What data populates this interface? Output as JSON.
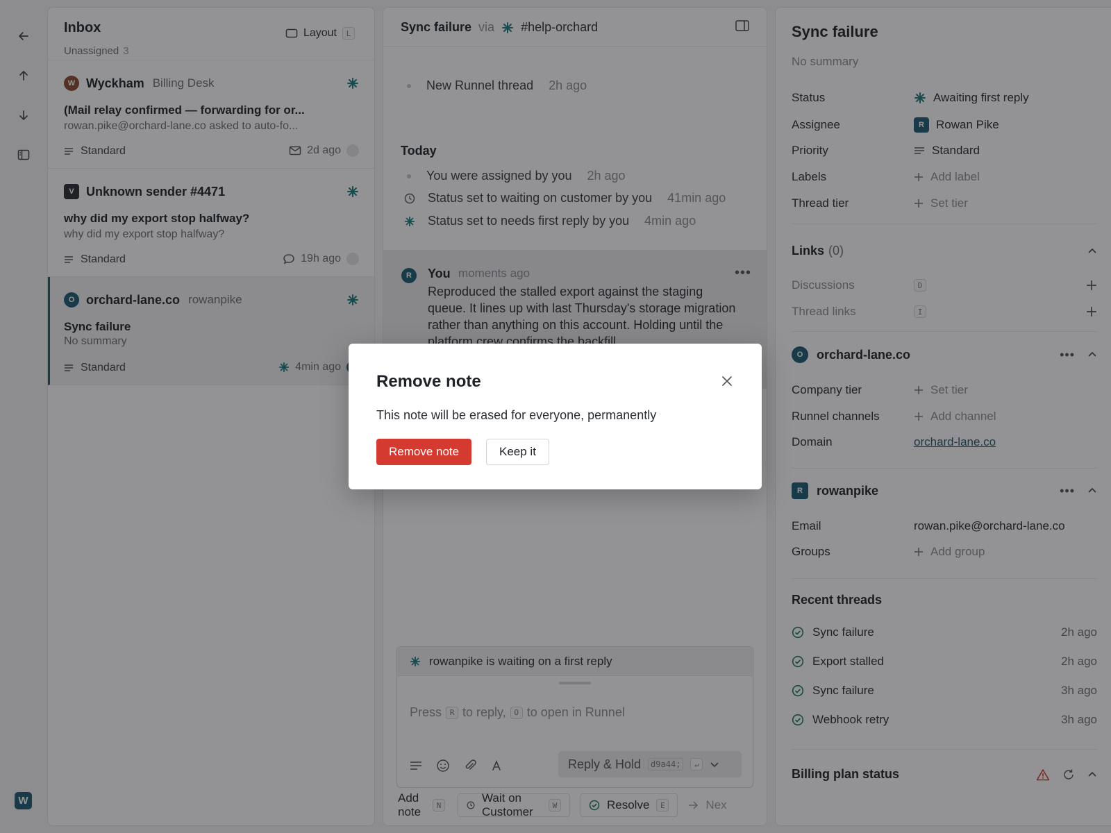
{
  "colors": {
    "accent": "#1d5c74",
    "danger": "#d43a2f",
    "overlay": "rgba(20,20,24,0.46)"
  },
  "rail": {
    "icons": [
      "arrow-left-icon",
      "arrow-up-icon",
      "arrow-down-icon",
      "sidebar-icon"
    ],
    "logo": "W"
  },
  "inbox": {
    "title": "Inbox",
    "filter": "Unassigned",
    "count": "3",
    "layout_label": "Layout",
    "layout_key": "L",
    "cards": [
      {
        "avatar": "W",
        "avatar_color": "#8a4b2f",
        "name": "Wyckham",
        "team": "Billing Desk",
        "subject": "(Mail relay confirmed — forwarding for or...",
        "preview": "rowan.pike@orchard-lane.co asked to auto-fo...",
        "priority": "Standard",
        "channel_icon": "mail-icon",
        "ago": "2d ago"
      },
      {
        "avatar": "V",
        "avatar_color": "#2b2e33",
        "name": "Unknown sender #4471",
        "team": "",
        "subject": "why did my export stop halfway?",
        "preview": "why did my export stop halfway?",
        "priority": "Standard",
        "channel_icon": "chat-icon",
        "ago": "19h ago"
      },
      {
        "avatar": "O",
        "avatar_color": "#1d5c74",
        "name": "orchard-lane.co",
        "team": "rowanpike",
        "subject": "Sync failure",
        "preview": "No summary",
        "priority": "Standard",
        "channel_icon": "asterisk-icon",
        "ago": "4min ago"
      }
    ]
  },
  "conversation": {
    "title": "Sync failure",
    "via": "via",
    "channel": "#help-orchard",
    "first_event": {
      "text": "New Runnel thread",
      "ago": "2h ago"
    },
    "today_label": "Today",
    "events": [
      {
        "icon": "dot-icon",
        "text": "You were assigned by you",
        "ago": "2h ago"
      },
      {
        "icon": "clock-icon",
        "text": "Status set to waiting on customer by you",
        "ago": "41min ago"
      },
      {
        "icon": "asterisk-icon",
        "text": "Status set to needs first reply by you",
        "ago": "4min ago"
      }
    ],
    "note": {
      "avatar": "R",
      "author": "You",
      "time": "moments ago",
      "body": "Reproduced the stalled export against the staging queue. It lines up with last Thursday's storage migration rather than anything on this account. Holding until the platform crew confirms the backfill"
    },
    "composer": {
      "waiting": "rowanpike is waiting on a first reply",
      "placeholder_press": "Press",
      "key_reply": "R",
      "placeholder_reply": "to reply,",
      "key_open": "O",
      "placeholder_open": "to open in Runnel",
      "reply_label": "Reply & Hold",
      "reply_id": "d9a44;"
    },
    "actions": {
      "add_note": "Add note",
      "add_note_key": "N",
      "wait": "Wait on Customer",
      "wait_key": "W",
      "resolve": "Resolve",
      "resolve_key": "E",
      "next": "Nex"
    }
  },
  "detail": {
    "title": "Sync failure",
    "summary": "No summary",
    "props": {
      "status_k": "Status",
      "status_v": "Awaiting first reply",
      "assignee_k": "Assignee",
      "assignee_avatar": "R",
      "assignee_v": "Rowan Pike",
      "priority_k": "Priority",
      "priority_v": "Standard",
      "labels_k": "Labels",
      "labels_v": "Add label",
      "tier_k": "Thread tier",
      "tier_v": "Set tier"
    },
    "links": {
      "title": "Links",
      "count": "(0)",
      "discussions": "Discussions",
      "discussions_key": "D",
      "thread_links": "Thread links",
      "thread_links_key": "I"
    },
    "company": {
      "avatar": "O",
      "name": "orchard-lane.co",
      "tier_k": "Company tier",
      "tier_v": "Set tier",
      "channels_k": "Runnel channels",
      "channels_v": "Add channel",
      "domain_k": "Domain",
      "domain_v": "orchard-lane.co"
    },
    "user": {
      "avatar": "R",
      "name": "rowanpike",
      "email_k": "Email",
      "email_v": "rowan.pike@orchard-lane.co",
      "groups_k": "Groups",
      "groups_v": "Add group"
    },
    "recent": {
      "title": "Recent threads",
      "items": [
        {
          "label": "Sync failure",
          "ago": "2h ago"
        },
        {
          "label": "Export stalled",
          "ago": "2h ago"
        },
        {
          "label": "Sync failure",
          "ago": "3h ago"
        },
        {
          "label": "Webhook retry",
          "ago": "3h ago"
        }
      ]
    },
    "billing": {
      "title": "Billing plan status"
    }
  },
  "modal": {
    "title": "Remove note",
    "message": "This note will be erased for everyone, permanently",
    "confirm": "Remove note",
    "cancel": "Keep it"
  }
}
